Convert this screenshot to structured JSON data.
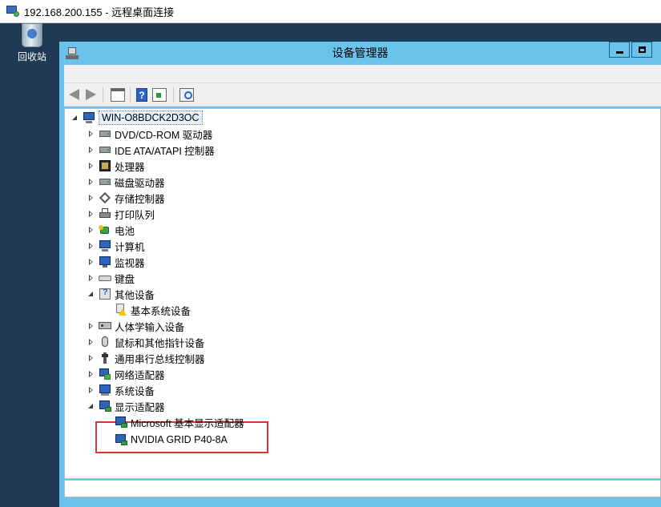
{
  "rdp": {
    "title": "192.168.200.155 - 远程桌面连接",
    "icon": "remote-desktop-icon"
  },
  "desktop": {
    "recycle_bin_label": "回收站",
    "recycle_bin_icon": "recycle-bin-icon"
  },
  "window": {
    "title": "设备管理器",
    "icon": "device-manager-icon",
    "titlebar_color": "#6bc2ea",
    "controls": [
      "minimize",
      "maximize"
    ]
  },
  "toolbar": {
    "buttons": [
      "back-icon",
      "forward-icon",
      "console-tree-icon",
      "help-icon",
      "properties-icon",
      "scan-hardware-icon"
    ]
  },
  "tree": {
    "root": {
      "label": "WIN-O8BDCK2D3OC",
      "icon": "computer-icon",
      "expanded": true
    },
    "items": [
      {
        "label": "DVD/CD-ROM 驱动器",
        "icon": "dvd-drive-icon",
        "level": 1,
        "state": "collapsed"
      },
      {
        "label": "IDE ATA/ATAPI 控制器",
        "icon": "ide-controller-icon",
        "level": 1,
        "state": "collapsed"
      },
      {
        "label": "处理器",
        "icon": "processor-icon",
        "level": 1,
        "state": "collapsed"
      },
      {
        "label": "磁盘驱动器",
        "icon": "disk-drive-icon",
        "level": 1,
        "state": "collapsed"
      },
      {
        "label": "存储控制器",
        "icon": "storage-controller-icon",
        "level": 1,
        "state": "collapsed"
      },
      {
        "label": "打印队列",
        "icon": "printer-icon",
        "level": 1,
        "state": "collapsed"
      },
      {
        "label": "电池",
        "icon": "battery-icon",
        "level": 1,
        "state": "collapsed"
      },
      {
        "label": "计算机",
        "icon": "computer-icon",
        "level": 1,
        "state": "collapsed"
      },
      {
        "label": "监视器",
        "icon": "monitor-icon",
        "level": 1,
        "state": "collapsed"
      },
      {
        "label": "键盘",
        "icon": "keyboard-icon",
        "level": 1,
        "state": "collapsed"
      },
      {
        "label": "其他设备",
        "icon": "other-devices-icon",
        "level": 1,
        "state": "expanded"
      },
      {
        "label": "基本系统设备",
        "icon": "warning-device-icon",
        "level": 2,
        "state": "leaf"
      },
      {
        "label": "人体学输入设备",
        "icon": "hid-icon",
        "level": 1,
        "state": "collapsed"
      },
      {
        "label": "鼠标和其他指针设备",
        "icon": "mouse-icon",
        "level": 1,
        "state": "collapsed"
      },
      {
        "label": "通用串行总线控制器",
        "icon": "usb-icon",
        "level": 1,
        "state": "collapsed"
      },
      {
        "label": "网络适配器",
        "icon": "network-adapter-icon",
        "level": 1,
        "state": "collapsed"
      },
      {
        "label": "系统设备",
        "icon": "system-devices-icon",
        "level": 1,
        "state": "collapsed"
      },
      {
        "label": "显示适配器",
        "icon": "display-adapter-icon",
        "level": 1,
        "state": "expanded"
      },
      {
        "label": "Microsoft 基本显示适配器",
        "icon": "display-adapter-icon",
        "level": 2,
        "state": "leaf"
      },
      {
        "label": "NVIDIA GRID P40-8A",
        "icon": "display-adapter-icon",
        "level": 2,
        "state": "leaf",
        "highlighted": true
      }
    ]
  },
  "highlight_color": "#e0303a"
}
